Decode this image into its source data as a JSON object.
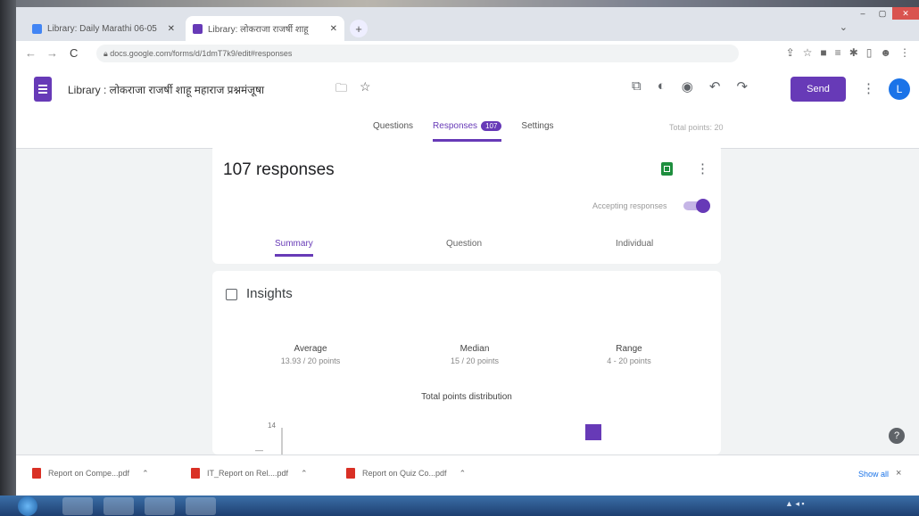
{
  "browser": {
    "tabs": [
      {
        "title": "Library: Daily Marathi 06-05",
        "favicon_color": "#4285f4"
      },
      {
        "title": "Library: लोकराजा राजर्षी शाहू",
        "favicon_color": "#673ab7"
      }
    ],
    "new_tab": "+",
    "url": "docs.google.com/forms/d/1dmT7k9/edit#responses",
    "nav": {
      "back": "←",
      "forward": "→",
      "reload": "C"
    }
  },
  "form": {
    "title": "Library : लोकराजा राजर्षी शाहू महाराज प्रश्नमंजूषा",
    "send_label": "Send",
    "avatar_initial": "L",
    "tabs": [
      {
        "label": "Questions"
      },
      {
        "label": "Responses",
        "badge": "107"
      },
      {
        "label": "Settings"
      }
    ],
    "total_points": "Total points: 20"
  },
  "responses": {
    "title": "107 responses",
    "accepting_label": "Accepting responses",
    "subtabs": [
      "Summary",
      "Question",
      "Individual"
    ]
  },
  "insights": {
    "title": "Insights",
    "stats": [
      {
        "label": "Average",
        "value": "13.93 / 20 points"
      },
      {
        "label": "Median",
        "value": "15 / 20 points"
      },
      {
        "label": "Range",
        "value": "4 - 20 points"
      }
    ],
    "chart_title": "Total points distribution",
    "accent": "#673ab7"
  },
  "chart_data": {
    "type": "bar",
    "title": "Total points distribution",
    "ylim": [
      0,
      14
    ],
    "y_tick_visible": "14",
    "values_visible": [
      {
        "x_fraction_label": "",
        "value": 14
      }
    ]
  },
  "downloads": {
    "items": [
      "Report on Compe...pdf",
      "IT_Report on Rel....pdf",
      "Report on Quiz Co...pdf"
    ],
    "show_all": "Show all",
    "close": "×"
  },
  "help_label": "?"
}
